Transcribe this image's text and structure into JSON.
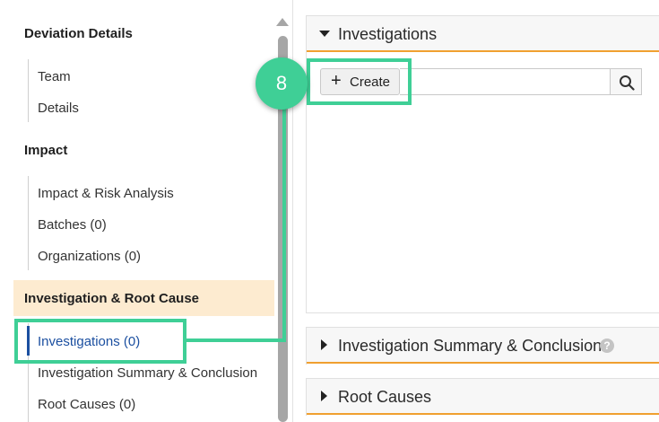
{
  "sidebar": {
    "section_deviation": "Deviation Details",
    "team": "Team",
    "details": "Details",
    "section_impact": "Impact",
    "impact_risk": "Impact & Risk Analysis",
    "batches": "Batches (0)",
    "organizations": "Organizations (0)",
    "section_investigation": "Investigation & Root Cause",
    "investigations": "Investigations (0)",
    "investigation_summary": "Investigation Summary & Conclusion",
    "root_causes": "Root Causes (0)"
  },
  "panels": {
    "investigations_title": "Investigations",
    "create_label": "Create",
    "search_placeholder": "",
    "summary_title": "Investigation Summary & Conclusion",
    "root_causes_title": "Root Causes"
  },
  "annotation": {
    "step_number": "8",
    "color": "#3fcf96"
  },
  "icons": {
    "help": "?",
    "plus": "+"
  },
  "colors": {
    "active_bg": "#fdebd0",
    "active_text": "#1b4fa0",
    "panel_accent": "#f0a030"
  }
}
